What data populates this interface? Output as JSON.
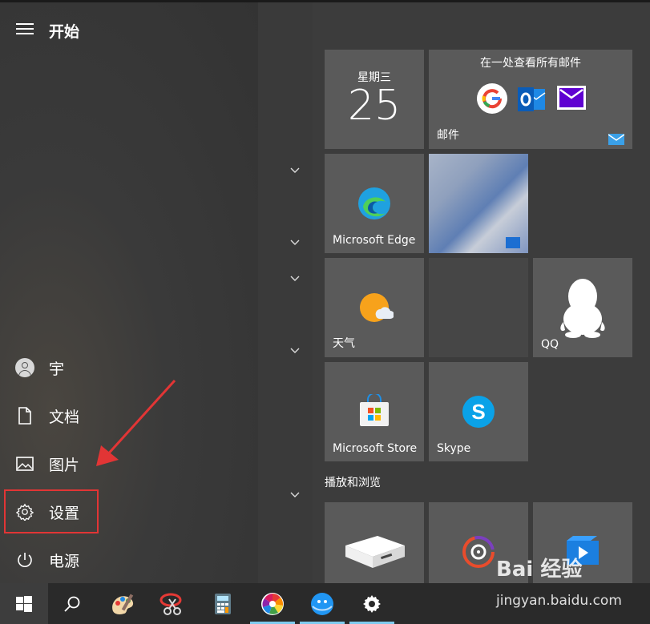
{
  "header": {
    "title": "开始"
  },
  "sidebar": {
    "items": [
      {
        "label": "宇",
        "icon": "user-avatar-icon"
      },
      {
        "label": "文档",
        "icon": "document-icon"
      },
      {
        "label": "图片",
        "icon": "pictures-icon"
      },
      {
        "label": "设置",
        "icon": "gear-icon"
      },
      {
        "label": "电源",
        "icon": "power-icon"
      }
    ]
  },
  "tiles": {
    "calendar": {
      "day": "星期三",
      "date": "25"
    },
    "mail": {
      "heading": "在一处查看所有邮件",
      "label": "邮件"
    },
    "edge": {
      "label": "Microsoft Edge"
    },
    "weather": {
      "label": "天气"
    },
    "qq": {
      "label": "QQ"
    },
    "store": {
      "label": "Microsoft Store"
    },
    "skype": {
      "label": "Skype"
    }
  },
  "sections": {
    "play_browse": "播放和浏览"
  },
  "taskbar": {
    "items": [
      "windows-start-icon",
      "search-icon",
      "paint-icon",
      "snipping-tool-icon",
      "calculator-icon",
      "pinwheel-app-icon",
      "browser-globe-icon",
      "gear-icon"
    ]
  },
  "watermark": {
    "logo": "Bai 经验",
    "url": "jingyan.baidu.com"
  },
  "colors": {
    "accent_highlight": "#e23535",
    "tile_bg": "#5a5a5a",
    "taskbar_active": "#7ecbef"
  }
}
